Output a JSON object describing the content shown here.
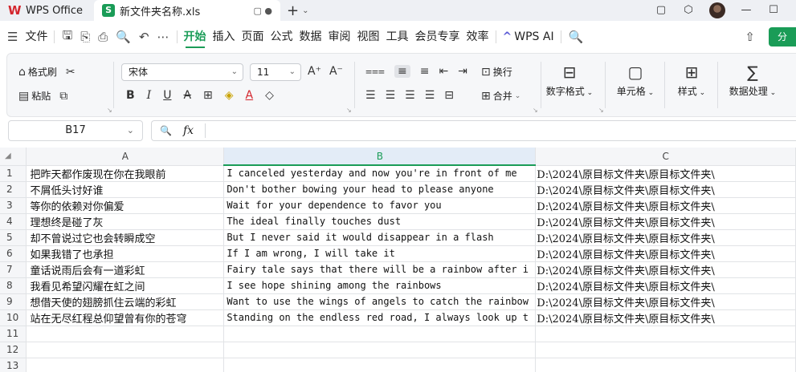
{
  "titlebar": {
    "app_name": "WPS Office",
    "app_logo": "W",
    "doc_logo": "S",
    "doc_title": "新文件夹名称.xls",
    "tab_controls": "▢ ●",
    "new_tab": "+",
    "new_tab_caret": "⌄",
    "window_buttons": [
      "▢",
      "⬡",
      "—",
      "☐"
    ]
  },
  "menubar": {
    "file_icon": "☰",
    "file_label": "文件",
    "quick_icons": [
      "🖫",
      "⎘",
      "⎙",
      "🔍",
      "↶",
      "⋯"
    ],
    "tabs": [
      "开始",
      "插入",
      "页面",
      "公式",
      "数据",
      "审阅",
      "视图",
      "工具",
      "会员专享",
      "效率"
    ],
    "active_tab": "开始",
    "ai_label": "WPS AI",
    "search_icon": "🔍",
    "cloud_icon": "⇧",
    "share_label": "分"
  },
  "ribbon": {
    "format_painter": "格式刷",
    "paste": "粘贴",
    "font_name": "宋体",
    "font_size": "11",
    "grow_font": "A⁺",
    "shrink_font": "A⁻",
    "bold": "B",
    "italic": "I",
    "underline": "U",
    "strike": "A",
    "border": "⊞",
    "fill": "◈",
    "font_color": "A",
    "clear": "◇",
    "wrap": "换行",
    "merge": "合并",
    "number_format": "数字格式",
    "cell": "单元格",
    "style": "样式",
    "data_processing": "数据处理",
    "align_top": "⩶",
    "align_mid": "≡",
    "align_bot": "≡",
    "indent_less": "⇤",
    "indent_more": "⇥",
    "align_left": "☰",
    "align_center": "☰",
    "align_right": "☰",
    "justify": "☰",
    "distributed": "⊟"
  },
  "formula_bar": {
    "cell_ref": "B17",
    "zoom_icon": "🔍",
    "fx": "fx",
    "content": ""
  },
  "grid": {
    "columns": [
      "A",
      "B",
      "C"
    ],
    "selected_column": "B",
    "rows": [
      {
        "n": "1",
        "a": "把昨天都作废现在你在我眼前",
        "b": "I canceled yesterday and now you're in front of me",
        "c": "D:\\2024\\原目标文件夹\\原目标文件夹\\"
      },
      {
        "n": "2",
        "a": "不屑低头讨好谁",
        "b": "Don't bother bowing your head to please anyone",
        "c": "D:\\2024\\原目标文件夹\\原目标文件夹\\"
      },
      {
        "n": "3",
        "a": "等你的依赖对你偏爱",
        "b": "Wait for your dependence to favor you",
        "c": "D:\\2024\\原目标文件夹\\原目标文件夹\\"
      },
      {
        "n": "4",
        "a": "理想终是碰了灰",
        "b": "The ideal finally touches dust",
        "c": "D:\\2024\\原目标文件夹\\原目标文件夹\\"
      },
      {
        "n": "5",
        "a": "却不曾说过它也会转瞬成空",
        "b": "But I never said it would disappear in a flash",
        "c": "D:\\2024\\原目标文件夹\\原目标文件夹\\"
      },
      {
        "n": "6",
        "a": "如果我错了也承担",
        "b": "If I am wrong, I will take it",
        "c": "D:\\2024\\原目标文件夹\\原目标文件夹\\"
      },
      {
        "n": "7",
        "a": "童话说雨后会有一道彩虹",
        "b": "Fairy tale says that there will be a rainbow after i",
        "c": "D:\\2024\\原目标文件夹\\原目标文件夹\\"
      },
      {
        "n": "8",
        "a": "我看见希望闪耀在虹之间",
        "b": "I see hope shining among the rainbows",
        "c": "D:\\2024\\原目标文件夹\\原目标文件夹\\"
      },
      {
        "n": "9",
        "a": "想借天使的翅膀抓住云端的彩虹",
        "b": "Want to use the wings of angels to catch the rainbow",
        "c": "D:\\2024\\原目标文件夹\\原目标文件夹\\"
      },
      {
        "n": "10",
        "a": "站在无尽红程总仰望曾有你的苍穹",
        "b": "Standing on the endless red road, I always look up t",
        "c": "D:\\2024\\原目标文件夹\\原目标文件夹\\"
      },
      {
        "n": "11",
        "a": "",
        "b": "",
        "c": ""
      },
      {
        "n": "12",
        "a": "",
        "b": "",
        "c": ""
      },
      {
        "n": "13",
        "a": "",
        "b": "",
        "c": ""
      }
    ]
  }
}
